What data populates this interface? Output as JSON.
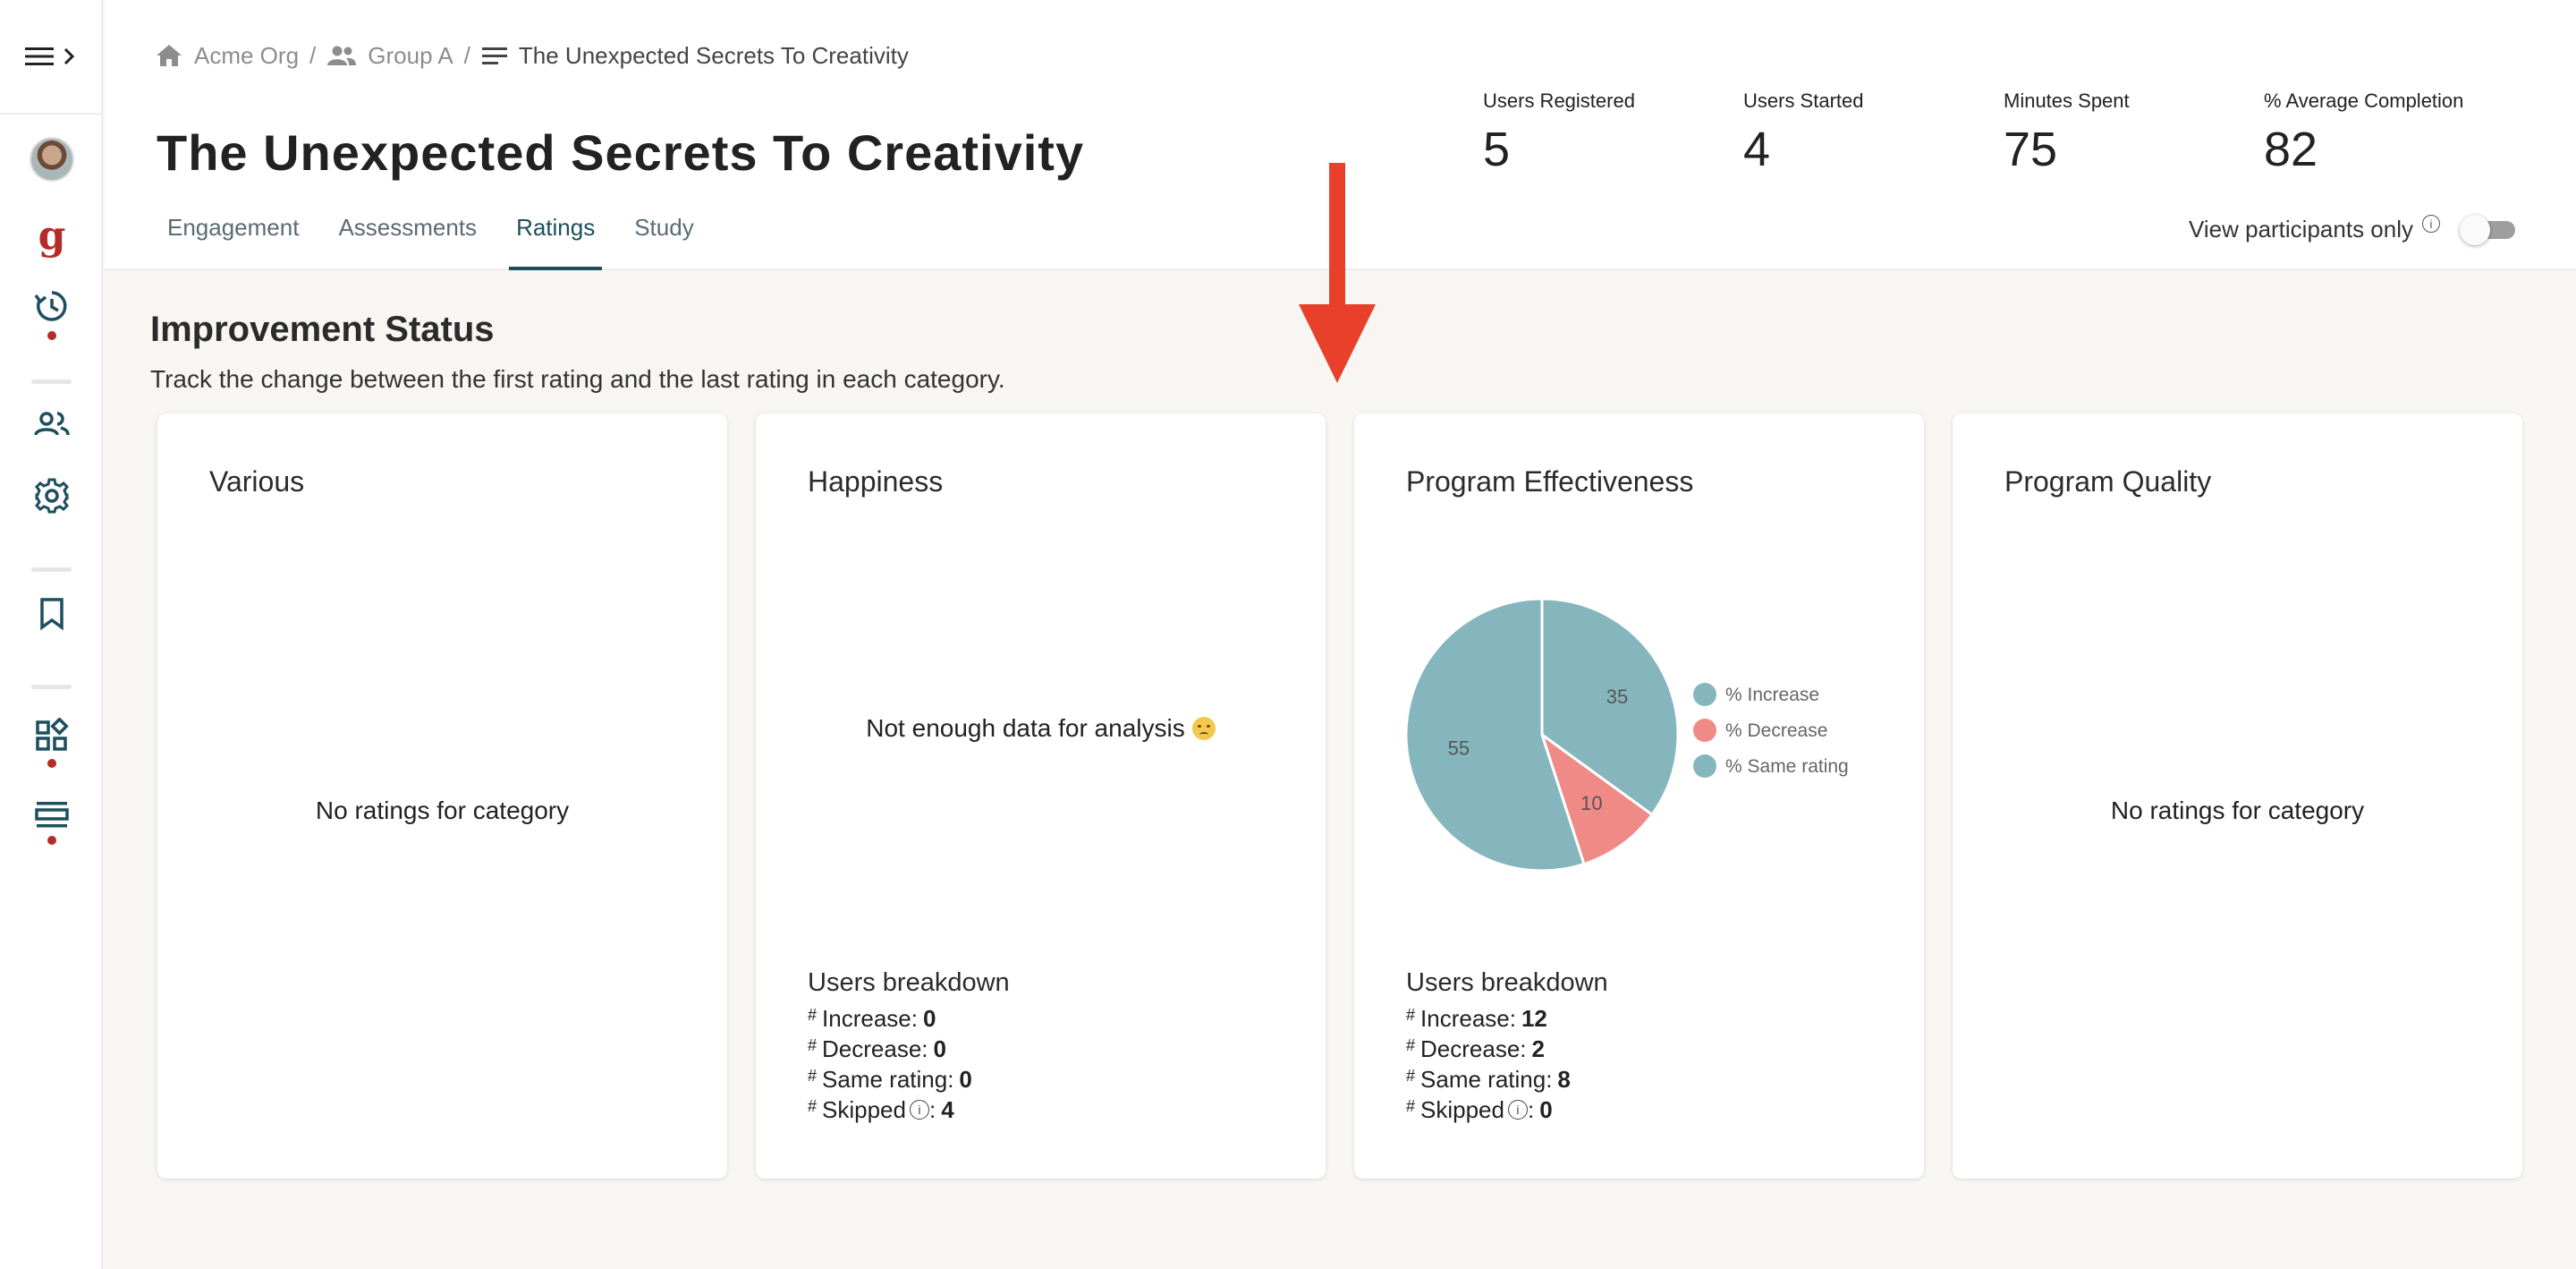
{
  "sidebar": {
    "menu_icon": "menu-icon",
    "expand_icon": "chevron-right-icon",
    "items": [
      {
        "name": "avatar",
        "icon": "user-avatar"
      },
      {
        "name": "brand",
        "icon": "brand-g-icon",
        "glyph": "g"
      },
      {
        "name": "history",
        "icon": "history-icon"
      },
      {
        "name": "people",
        "icon": "people-icon"
      },
      {
        "name": "settings",
        "icon": "gear-icon"
      },
      {
        "name": "bookmark",
        "icon": "bookmark-icon"
      },
      {
        "name": "widgets",
        "icon": "widgets-icon"
      },
      {
        "name": "list",
        "icon": "list-view-icon"
      }
    ],
    "accent": "#1d4f5e",
    "dot_color": "#b52b27"
  },
  "breadcrumb": [
    {
      "label": "Acme Org",
      "icon": "home-icon"
    },
    {
      "label": "Group A",
      "icon": "group-icon"
    },
    {
      "label": "The Unexpected Secrets To Creativity",
      "icon": "list-icon"
    }
  ],
  "breadcrumb_sep": "/",
  "page_title": "The Unexpected Secrets To Creativity",
  "tabs": [
    {
      "label": "Engagement",
      "active": false
    },
    {
      "label": "Assessments",
      "active": false
    },
    {
      "label": "Ratings",
      "active": true
    },
    {
      "label": "Study",
      "active": false
    }
  ],
  "stats": [
    {
      "label": "Users Registered",
      "value": "5"
    },
    {
      "label": "Users Started",
      "value": "4"
    },
    {
      "label": "Minutes Spent",
      "value": "75"
    },
    {
      "label": "% Average Completion",
      "value": "82"
    }
  ],
  "view_participants": {
    "label": "View participants only",
    "info": "i",
    "enabled": false
  },
  "section": {
    "title": "Improvement Status",
    "subtitle": "Track the change between the first rating and the last rating in each category."
  },
  "cards": [
    {
      "title": "Various",
      "empty_text": "No ratings for category"
    },
    {
      "title": "Happiness",
      "nodata_text": "Not enough data for analysis",
      "breakdown": {
        "title": "Users breakdown",
        "hash": "#",
        "increase_label": "Increase:",
        "increase": "0",
        "decrease_label": "Decrease:",
        "decrease": "0",
        "same_label": "Same rating:",
        "same": "0",
        "skipped_label": "Skipped",
        "skipped": "4",
        "info": "i"
      }
    },
    {
      "title": "Program Effectiveness",
      "breakdown": {
        "title": "Users breakdown",
        "hash": "#",
        "increase_label": "Increase:",
        "increase": "12",
        "decrease_label": "Decrease:",
        "decrease": "2",
        "same_label": "Same rating:",
        "same": "8",
        "skipped_label": "Skipped",
        "skipped": "0",
        "info": "i"
      }
    },
    {
      "title": "Program Quality",
      "empty_text": "No ratings for category"
    }
  ],
  "chart_data": {
    "type": "pie",
    "categories": [
      "% Increase",
      "% Decrease",
      "% Same rating"
    ],
    "values": [
      35,
      10,
      55
    ],
    "colors": [
      "#86b6bd",
      "#f08a86",
      "#86b6bd"
    ],
    "legend_position": "right"
  },
  "annotation_arrow_color": "#e8402a"
}
